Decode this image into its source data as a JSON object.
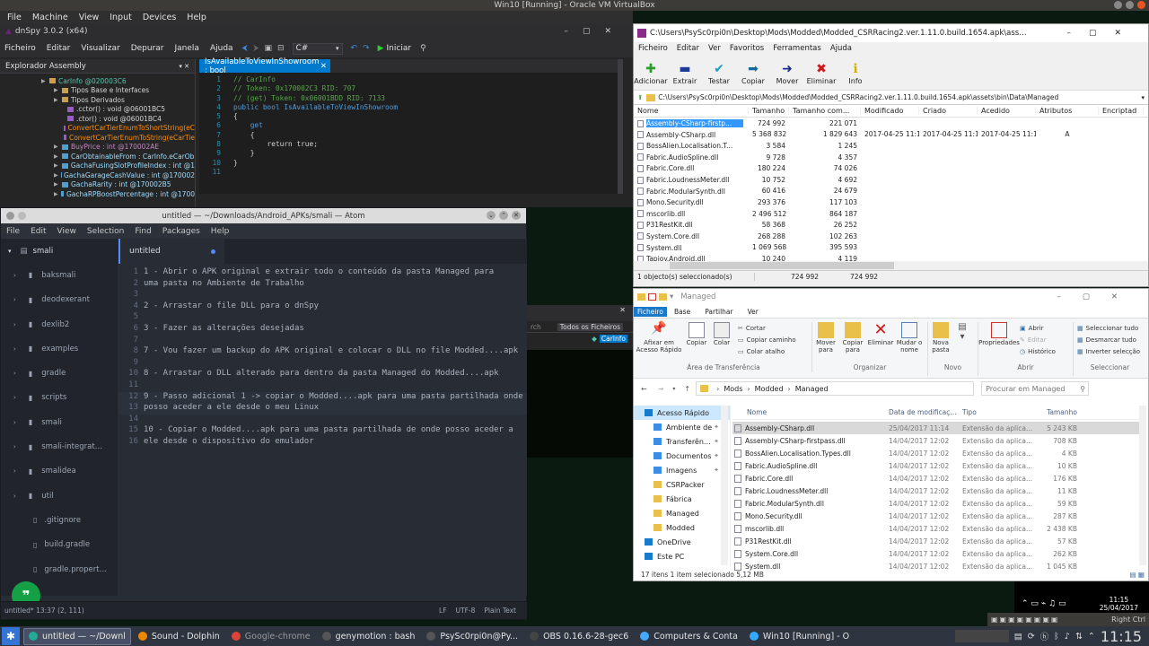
{
  "vbox": {
    "title": "Win10 [Running] - Oracle VM VirtualBox",
    "menu": [
      "File",
      "Machine",
      "View",
      "Input",
      "Devices",
      "Help"
    ]
  },
  "dnspy": {
    "title": "dnSpy 3.0.2 (x64)",
    "menu": [
      "Ficheiro",
      "Editar",
      "Visualizar",
      "Depurar",
      "Janela",
      "Ajuda"
    ],
    "lang": "C#",
    "start_label": "Iniciar",
    "tree_header": "Explorador Assembly",
    "tree": [
      {
        "text": "CarInfo @020003C6",
        "color": "#4ec9b0",
        "indent": 46
      },
      {
        "text": "Tipos Base e Interfaces",
        "color": "#d4d4d4",
        "indent": 60
      },
      {
        "text": "Tipos Derivados",
        "color": "#d4d4d4",
        "indent": 60
      },
      {
        "text": ".cctor() : void @06001BC5",
        "color": "#d4d4d4",
        "indent": 66
      },
      {
        "text": ".ctor() : void @06001BC4",
        "color": "#d4d4d4",
        "indent": 66
      },
      {
        "text": "ConvertCarTierEnumToShortString(eC",
        "color": "#ff8c00",
        "indent": 66
      },
      {
        "text": "ConvertCarTierEnumToString(eCarTie",
        "color": "#ff8c00",
        "indent": 66
      },
      {
        "text": "BuyPrice : int @170002AE",
        "color": "#c586c0",
        "indent": 60
      },
      {
        "text": "CarObtainableFrom : CarInfo.eCarOb",
        "color": "#9cdcfe",
        "indent": 60
      },
      {
        "text": "GachaFusingSlotProfileIndex : int @1",
        "color": "#9cdcfe",
        "indent": 60
      },
      {
        "text": "GachaGarageCashValue : int @170002",
        "color": "#9cdcfe",
        "indent": 60
      },
      {
        "text": "GachaRarity : int @170002B5",
        "color": "#9cdcfe",
        "indent": 60
      },
      {
        "text": "GachaRPBoostPercentage : int @1700",
        "color": "#9cdcfe",
        "indent": 60
      }
    ],
    "tab": "IsAvailableToViewInShowroom : bool",
    "code": [
      {
        "n": "1",
        "t": "// CarInfo",
        "c": "#57a64a"
      },
      {
        "n": "2",
        "t": "// Token: 0x170002C3 RID: 707",
        "c": "#57a64a"
      },
      {
        "n": "3",
        "t": "// (get) Token: 0x06001BDD RID: 7133",
        "c": "#57a64a"
      },
      {
        "n": "4",
        "t": "public bool IsAvailableToViewInShowroom",
        "c": "#569cd6"
      },
      {
        "n": "5",
        "t": "{",
        "c": "#d4d4d4"
      },
      {
        "n": "6",
        "t": "    get",
        "c": "#569cd6"
      },
      {
        "n": "7",
        "t": "    {",
        "c": "#d4d4d4"
      },
      {
        "n": "8",
        "t": "        return true;",
        "c": "#d4d4d4"
      },
      {
        "n": "9",
        "t": "    }",
        "c": "#d4d4d4"
      },
      {
        "n": "10",
        "t": "}",
        "c": "#d4d4d4"
      },
      {
        "n": "11",
        "t": "",
        "c": "#d4d4d4"
      }
    ],
    "bottom_tab": "Todos os Ficheiros",
    "bottom_item": "CarInfo"
  },
  "atom": {
    "title": "untitled — ~/Downloads/Android_APKs/smali — Atom",
    "menu": [
      "File",
      "Edit",
      "View",
      "Selection",
      "Find",
      "Packages",
      "Help"
    ],
    "root": "smali",
    "tree": [
      {
        "name": "baksmali",
        "dir": true
      },
      {
        "name": "deodexerant",
        "dir": true
      },
      {
        "name": "dexlib2",
        "dir": true
      },
      {
        "name": "examples",
        "dir": true
      },
      {
        "name": "gradle",
        "dir": true
      },
      {
        "name": "scripts",
        "dir": true
      },
      {
        "name": "smali",
        "dir": true
      },
      {
        "name": "smali-integration-tests",
        "dir": true
      },
      {
        "name": "smalidea",
        "dir": true
      },
      {
        "name": "util",
        "dir": true
      },
      {
        "name": ".gitignore",
        "dir": false
      },
      {
        "name": "build.gradle",
        "dir": false
      },
      {
        "name": "gradle.properties",
        "dir": false
      }
    ],
    "tab": "untitled",
    "lines": [
      {
        "n": "1",
        "t": "1 - Abrir o APK original e extrair todo o conteúdo da pasta Managed para",
        "hl": false
      },
      {
        "n": "2",
        "t": "uma pasta no Ambiente de Trabalho",
        "hl": false
      },
      {
        "n": "3",
        "t": "",
        "hl": false
      },
      {
        "n": "4",
        "t": "2 - Arrastar o file DLL para o dnSpy",
        "hl": false
      },
      {
        "n": "5",
        "t": "",
        "hl": false
      },
      {
        "n": "6",
        "t": "3 - Fazer as alterações desejadas",
        "hl": false
      },
      {
        "n": "7",
        "t": "",
        "hl": false
      },
      {
        "n": "8",
        "t": "7 - Vou fazer um backup do APK original e colocar o DLL no file Modded....apk",
        "hl": false
      },
      {
        "n": "9",
        "t": "",
        "hl": false
      },
      {
        "n": "10",
        "t": "8 - Arrastar o DLL alterado para dentro da pasta Managed do Modded....apk",
        "hl": false
      },
      {
        "n": "11",
        "t": "",
        "hl": false
      },
      {
        "n": "12",
        "t": "9 - Passo adicional 1 -> copiar o Modded....apk para uma pasta partilhada onde",
        "hl": true
      },
      {
        "n": "13",
        "t": "posso aceder a ele desde o meu Linux",
        "hl": true
      },
      {
        "n": "14",
        "t": "",
        "hl": false
      },
      {
        "n": "15",
        "t": "10 - Copiar o Modded....apk para uma pasta partilhada de onde posso aceder a",
        "hl": false
      },
      {
        "n": "16",
        "t": "ele desde o dispositivo do emulador",
        "hl": false
      }
    ],
    "status_left": "untitled*  13:37  (2, 111)",
    "status_right": [
      "LF",
      "UTF-8",
      "Plain Text"
    ]
  },
  "winrar": {
    "title": "C:\\Users\\PsySc0rpi0n\\Desktop\\Mods\\Modded\\Modded_CSRRacing2.ver.1.11.0.build.1654.apk\\assets\\bin\\Data\\Managed\\",
    "menu": [
      "Ficheiro",
      "Editar",
      "Ver",
      "Favoritos",
      "Ferramentas",
      "Ajuda"
    ],
    "toolbar": [
      {
        "label": "Adicionar",
        "color": "#2a9d2a",
        "icon": "plus-icon"
      },
      {
        "label": "Extrair",
        "color": "#1a3a9a",
        "icon": "minus-icon"
      },
      {
        "label": "Testar",
        "color": "#1aa0c0",
        "icon": "check-icon"
      },
      {
        "label": "Copiar",
        "color": "#136a9a",
        "icon": "copy-icon"
      },
      {
        "label": "Mover",
        "color": "#1a2a8a",
        "icon": "arrow-icon"
      },
      {
        "label": "Eliminar",
        "color": "#d01818",
        "icon": "delete-icon"
      },
      {
        "label": "Info",
        "color": "#d0b000",
        "icon": "info-icon"
      }
    ],
    "address": "C:\\Users\\PsySc0rpi0n\\Desktop\\Mods\\Modded\\Modded_CSRRacing2.ver.1.11.0.build.1654.apk\\assets\\bin\\Data\\Managed",
    "columns": [
      "Nome",
      "Tamanho",
      "Tamanho com...",
      "Modificado",
      "Criado",
      "Acedido",
      "Atributos",
      "Encriptad"
    ],
    "rows": [
      {
        "name": "Assembly-CSharp-firstp...",
        "size": "724 992",
        "packed": "221 071",
        "mod": "",
        "cre": "",
        "acc": "",
        "attr": "",
        "sel": true
      },
      {
        "name": "Assembly-CSharp.dll",
        "size": "5 368 832",
        "packed": "1 829 643",
        "mod": "2017-04-25 11:14",
        "cre": "2017-04-25 11:12",
        "acc": "2017-04-25 11:12",
        "attr": "A",
        "sel": false
      },
      {
        "name": "BossAlien.Localisation.T...",
        "size": "3 584",
        "packed": "1 245",
        "mod": "",
        "cre": "",
        "acc": "",
        "attr": "",
        "sel": false
      },
      {
        "name": "Fabric.AudioSpline.dll",
        "size": "9 728",
        "packed": "4 357",
        "mod": "",
        "cre": "",
        "acc": "",
        "attr": "",
        "sel": false
      },
      {
        "name": "Fabric.Core.dll",
        "size": "180 224",
        "packed": "74 026",
        "mod": "",
        "cre": "",
        "acc": "",
        "attr": "",
        "sel": false
      },
      {
        "name": "Fabric.LoudnessMeter.dll",
        "size": "10 752",
        "packed": "4 692",
        "mod": "",
        "cre": "",
        "acc": "",
        "attr": "",
        "sel": false
      },
      {
        "name": "Fabric.ModularSynth.dll",
        "size": "60 416",
        "packed": "24 679",
        "mod": "",
        "cre": "",
        "acc": "",
        "attr": "",
        "sel": false
      },
      {
        "name": "Mono.Security.dll",
        "size": "293 376",
        "packed": "117 103",
        "mod": "",
        "cre": "",
        "acc": "",
        "attr": "",
        "sel": false
      },
      {
        "name": "mscorlib.dll",
        "size": "2 496 512",
        "packed": "864 187",
        "mod": "",
        "cre": "",
        "acc": "",
        "attr": "",
        "sel": false
      },
      {
        "name": "P31RestKit.dll",
        "size": "58 368",
        "packed": "26 252",
        "mod": "",
        "cre": "",
        "acc": "",
        "attr": "",
        "sel": false
      },
      {
        "name": "System.Core.dll",
        "size": "268 288",
        "packed": "102 263",
        "mod": "",
        "cre": "",
        "acc": "",
        "attr": "",
        "sel": false
      },
      {
        "name": "System.dll",
        "size": "1 069 568",
        "packed": "395 593",
        "mod": "",
        "cre": "",
        "acc": "",
        "attr": "",
        "sel": false
      },
      {
        "name": "Tapjoy.Android.dll",
        "size": "10 240",
        "packed": "4 119",
        "mod": "",
        "cre": "",
        "acc": "",
        "attr": "",
        "sel": false
      }
    ],
    "status": "1 objecto(s) seleccionado(s)",
    "status_size": "724 992",
    "status_packed": "724 992"
  },
  "explorer": {
    "title": "Managed",
    "tabs": [
      "Ficheiro",
      "Base",
      "Partilhar",
      "Ver"
    ],
    "ribbon": {
      "pin": "Afixar em Acesso Rápido",
      "copy": "Copiar",
      "paste": "Colar",
      "cut": "Cortar",
      "copy_path": "Copiar caminho",
      "paste_shortcut": "Colar atalho",
      "move": "Mover para",
      "copyto": "Copiar para",
      "delete": "Eliminar",
      "rename": "Mudar o nome",
      "newfolder": "Nova pasta",
      "props": "Propriedades",
      "open": "Abrir",
      "edit": "Editar",
      "history": "Histórico",
      "selall": "Seleccionar tudo",
      "selnone": "Desmarcar tudo",
      "selinv": "Inverter selecção",
      "g1": "Área de Transferência",
      "g2": "Organizar",
      "g3": "Novo",
      "g4": "Abrir",
      "g5": "Seleccionar"
    },
    "crumbs": [
      "Mods",
      "Modded",
      "Managed"
    ],
    "search_placeholder": "Procurar em Managed",
    "nav": [
      {
        "label": "Acesso Rápido",
        "pin": false
      },
      {
        "label": "Ambiente de",
        "pin": true
      },
      {
        "label": "Transferência",
        "pin": true
      },
      {
        "label": "Documentos",
        "pin": true
      },
      {
        "label": "Imagens",
        "pin": true
      },
      {
        "label": "CSRPacker",
        "pin": false
      },
      {
        "label": "Fábrica",
        "pin": false
      },
      {
        "label": "Managed",
        "pin": false
      },
      {
        "label": "Modded",
        "pin": false
      },
      {
        "label": "OneDrive",
        "pin": false
      },
      {
        "label": "Este PC",
        "pin": false
      }
    ],
    "columns": [
      "Nome",
      "Data de modificaç...",
      "Tipo",
      "Tamanho"
    ],
    "files": [
      {
        "name": "Assembly-CSharp.dll",
        "date": "25/04/2017 11:14",
        "type": "Extensão da aplica...",
        "size": "5 243 KB",
        "sel": true
      },
      {
        "name": "Assembly-CSharp-firstpass.dll",
        "date": "14/04/2017 12:02",
        "type": "Extensão da aplica...",
        "size": "708 KB",
        "sel": false
      },
      {
        "name": "BossAlien.Localisation.Types.dll",
        "date": "14/04/2017 12:02",
        "type": "Extensão da aplica...",
        "size": "4 KB",
        "sel": false
      },
      {
        "name": "Fabric.AudioSpline.dll",
        "date": "14/04/2017 12:02",
        "type": "Extensão da aplica...",
        "size": "10 KB",
        "sel": false
      },
      {
        "name": "Fabric.Core.dll",
        "date": "14/04/2017 12:02",
        "type": "Extensão da aplica...",
        "size": "176 KB",
        "sel": false
      },
      {
        "name": "Fabric.LoudnessMeter.dll",
        "date": "14/04/2017 12:02",
        "type": "Extensão da aplica...",
        "size": "11 KB",
        "sel": false
      },
      {
        "name": "Fabric.ModularSynth.dll",
        "date": "14/04/2017 12:02",
        "type": "Extensão da aplica...",
        "size": "59 KB",
        "sel": false
      },
      {
        "name": "Mono.Security.dll",
        "date": "14/04/2017 12:02",
        "type": "Extensão da aplica...",
        "size": "287 KB",
        "sel": false
      },
      {
        "name": "mscorlib.dll",
        "date": "14/04/2017 12:02",
        "type": "Extensão da aplica...",
        "size": "2 438 KB",
        "sel": false
      },
      {
        "name": "P31RestKit.dll",
        "date": "14/04/2017 12:02",
        "type": "Extensão da aplica...",
        "size": "57 KB",
        "sel": false
      },
      {
        "name": "System.Core.dll",
        "date": "14/04/2017 12:02",
        "type": "Extensão da aplica...",
        "size": "262 KB",
        "sel": false
      },
      {
        "name": "System.dll",
        "date": "14/04/2017 12:02",
        "type": "Extensão da aplica...",
        "size": "1 045 KB",
        "sel": false
      }
    ],
    "status": "17 itens    1 item selecionado 5,12 MB"
  },
  "win_tray": {
    "time": "11:15",
    "date": "25/04/2017"
  },
  "taskbar": {
    "items": [
      {
        "label": "untitled — ~/Downl",
        "active": true
      },
      {
        "label": "Sound - Dolphin",
        "active": false
      },
      {
        "label": "Google-chrome",
        "active": false
      },
      {
        "label": "genymotion : bash",
        "active": false
      },
      {
        "label": "PsySc0rpi0n@Py...",
        "active": false
      },
      {
        "label": "OBS 0.16.6-28-gec6",
        "active": false
      },
      {
        "label": "Computers & Conta",
        "active": false
      },
      {
        "label": "Win10 [Running] - O",
        "active": false
      }
    ],
    "clock": "11:15",
    "host_key": "Right Ctrl"
  }
}
